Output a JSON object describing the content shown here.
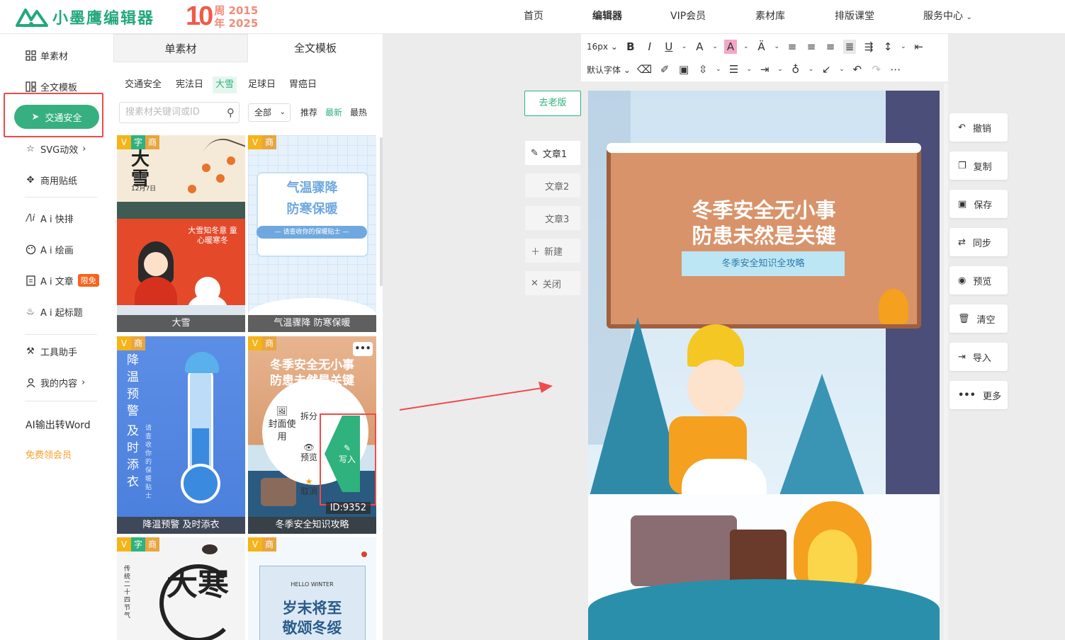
{
  "header": {
    "logo_name": "小墨鹰编辑器",
    "anniversary_number": "10",
    "anniversary_line1": "周 2015",
    "anniversary_line2": "年 2025",
    "nav": [
      "首页",
      "编辑器",
      "VIP会员",
      "素材库",
      "排版课堂",
      "服务中心"
    ]
  },
  "left_nav": {
    "items": [
      {
        "label": "单素材",
        "icon": "grid-icon"
      },
      {
        "label": "全文模板",
        "icon": "template-icon"
      },
      {
        "label": "交通安全",
        "icon": "send-icon"
      },
      {
        "label": "SVG动效",
        "icon": "star-icon"
      },
      {
        "label": "商用贴纸",
        "icon": "puzzle-icon"
      },
      {
        "label": "A i 快排",
        "icon": "ai-icon"
      },
      {
        "label": "A i 绘画",
        "icon": "palette-icon"
      },
      {
        "label": "A i 文章",
        "icon": "doc-icon",
        "badge": "限免"
      },
      {
        "label": "A i 起标题",
        "icon": "fire-icon"
      },
      {
        "label": "工具助手",
        "icon": "tools-icon"
      },
      {
        "label": "我的内容",
        "icon": "user-icon"
      }
    ],
    "word_export": "AI输出转Word",
    "free_vip": "免费领会员"
  },
  "panel": {
    "tabs": [
      "单素材",
      "全文模板"
    ],
    "categories": [
      "交通安全",
      "宪法日",
      "大雪",
      "足球日",
      "胃癌日"
    ],
    "search_placeholder": "搜素材关键词或ID",
    "select_value": "全部",
    "sort": [
      "推荐",
      "最新",
      "最热"
    ],
    "cards": [
      {
        "caption": "大雪",
        "tags": [
          "V",
          "字",
          "商"
        ],
        "poster_title": "大雪",
        "poster_date": "12月7日",
        "poster_sub": "大雪知冬意 童心暖寒冬"
      },
      {
        "caption": "气温骤降 防寒保暖",
        "tags": [
          "V",
          "商"
        ],
        "poster_title1": "气温骤降",
        "poster_title2": "防寒保暖",
        "poster_sub": "— 请查收你的保暖贴士 —"
      },
      {
        "caption": "降温预警 及时添衣",
        "tags": [
          "V",
          "商"
        ],
        "poster_v1": "降温预警",
        "poster_v2": "及时添衣",
        "poster_v3": "请查收你的保暖贴士"
      },
      {
        "caption": "冬季安全知识攻略",
        "tags": [
          "V",
          "商"
        ],
        "poster_title": "冬季安全无小事",
        "poster_title2": "防患未然是关键",
        "id_label": "ID:9352",
        "menu": [
          "拆分",
          "预览",
          "取消",
          "封面使用",
          "写入"
        ]
      },
      {
        "caption": "",
        "tags": [
          "V",
          "字",
          "商"
        ],
        "poster_big": "大寒",
        "poster_side": "传统二十四节气"
      },
      {
        "caption": "",
        "tags": [
          "V",
          "商"
        ],
        "poster_small": "HELLO WINTER",
        "poster_title1": "岁末将至",
        "poster_title2": "敬颂冬绥"
      }
    ]
  },
  "docs": {
    "old_version": "去老版",
    "items": [
      "文章1",
      "文章2",
      "文章3"
    ],
    "new": "新建",
    "close": "关闭"
  },
  "toolbar": {
    "font_size": "16px",
    "font_family": "默认字体"
  },
  "canvas": {
    "title1": "冬季安全无小事",
    "title2": "防患未然是关键",
    "subtitle": "冬季安全知识全攻略"
  },
  "right_tools": [
    "撤销",
    "复制",
    "保存",
    "同步",
    "预览",
    "清空",
    "导入",
    "更多"
  ],
  "colors": {
    "brand": "#2fb27e",
    "accent": "#f5641e",
    "highlight_box": "#f04a4a"
  }
}
